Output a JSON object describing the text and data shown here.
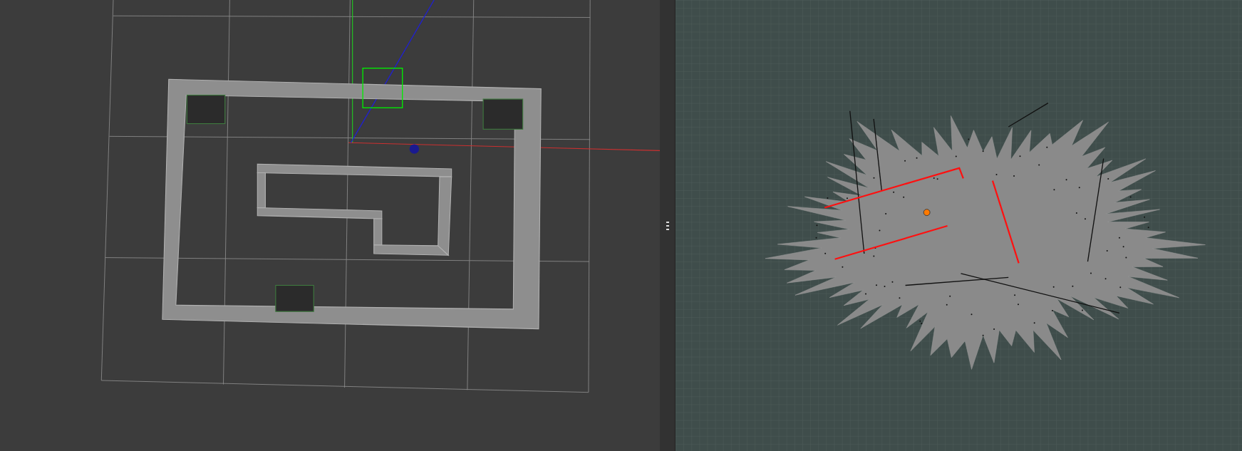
{
  "panes": [
    {
      "kind": "simulator-view"
    },
    {
      "kind": "map-view"
    }
  ]
}
